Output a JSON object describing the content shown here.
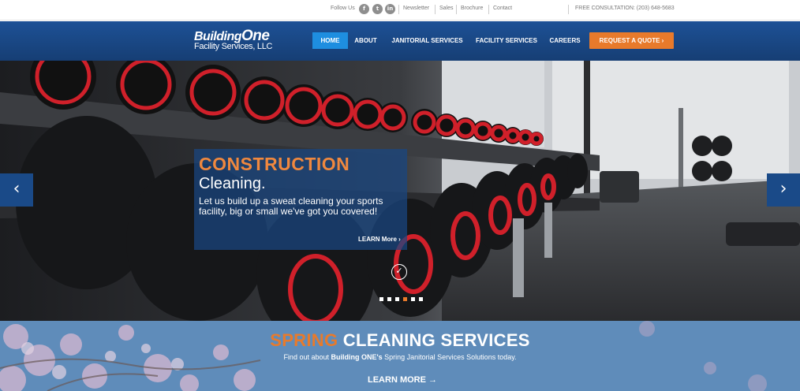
{
  "topbar": {
    "follow_label": "Follow Us",
    "social": [
      {
        "icon": "facebook-icon",
        "glyph": "f"
      },
      {
        "icon": "twitter-icon",
        "glyph": "t"
      },
      {
        "icon": "linkedin-icon",
        "glyph": "in"
      }
    ],
    "links": [
      "Newsletter",
      "Sales",
      "Brochure",
      "Contact"
    ],
    "consultation": "FREE CONSULTATION: (203) 648-5683"
  },
  "header": {
    "logo_line1": "Building",
    "logo_line1_b": "One",
    "logo_line2": "Facility Services, LLC",
    "nav": [
      "HOME",
      "ABOUT",
      "JANITORIAL SERVICES",
      "FACILITY SERVICES",
      "CAREERS"
    ],
    "cta": "REQUEST A QUOTE ›"
  },
  "hero": {
    "title": "CONSTRUCTION",
    "subtitle": "Cleaning.",
    "description": "Let us build up a sweat cleaning your sports facility, big or small we've got you covered!",
    "more": "LEARN More ›",
    "prev_glyph": "‹",
    "next_glyph": "›",
    "slides": 6,
    "active_slide": 4
  },
  "spring": {
    "title_accent": "SPRING",
    "title_rest": " CLEANING SERVICES",
    "desc_before": "Find out about ",
    "desc_bold": "Building ONE's",
    "desc_after": " Spring Janitorial Services Solutions today.",
    "more": "LEARN MORE →"
  },
  "colors": {
    "brand_blue": "#1a4a88",
    "accent_orange": "#e87a2b",
    "nav_active": "#1e8ee0"
  }
}
